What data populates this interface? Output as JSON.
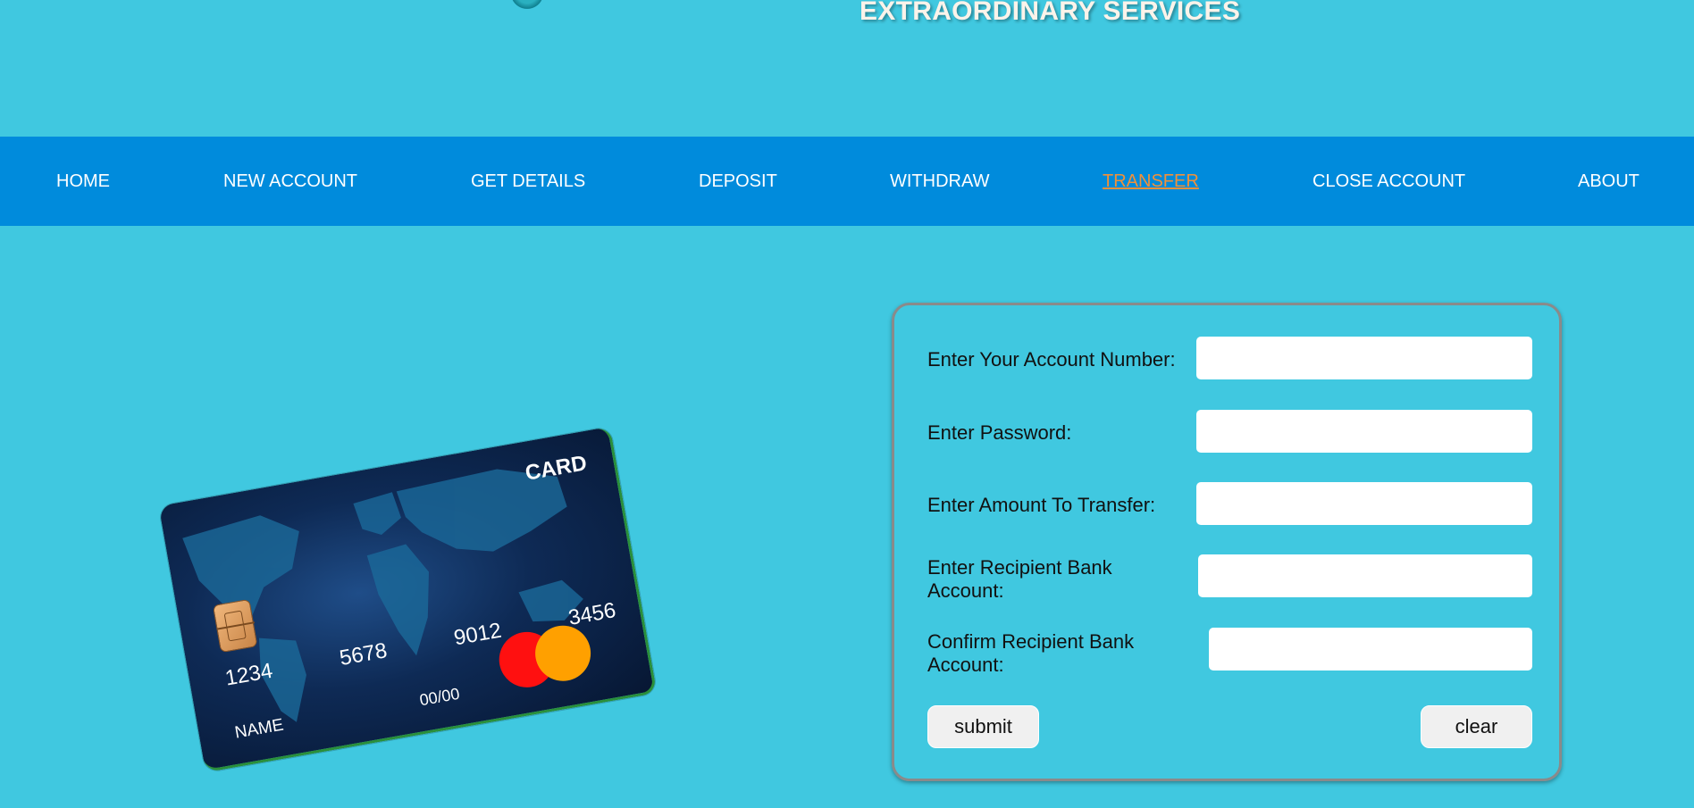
{
  "header": {
    "tagline": "EXTRAORDINARY SERVICES"
  },
  "nav": {
    "items": [
      {
        "label": "HOME"
      },
      {
        "label": "NEW ACCOUNT"
      },
      {
        "label": "GET DETAILS"
      },
      {
        "label": "DEPOSIT"
      },
      {
        "label": "WITHDRAW"
      },
      {
        "label": "TRANSFER",
        "active": true
      },
      {
        "label": "CLOSE ACCOUNT"
      },
      {
        "label": "ABOUT"
      }
    ],
    "active_color": "#f0903a"
  },
  "card": {
    "brand": "CARD",
    "number_groups": [
      "1234",
      "5678",
      "9012",
      "3456"
    ],
    "name": "NAME",
    "expiry": "00/00"
  },
  "form": {
    "fields": [
      {
        "label": "Enter Your Account Number:",
        "value": ""
      },
      {
        "label": "Enter Password:",
        "value": ""
      },
      {
        "label": "Enter Amount To Transfer:",
        "value": ""
      },
      {
        "label": "Enter Recipient Bank Account:",
        "value": ""
      },
      {
        "label": "Confirm Recipient Bank Account:",
        "value": ""
      }
    ],
    "submit_label": "submit",
    "clear_label": "clear"
  },
  "colors": {
    "page_background": "#40c8e0",
    "navbar_background": "#008bdc"
  }
}
